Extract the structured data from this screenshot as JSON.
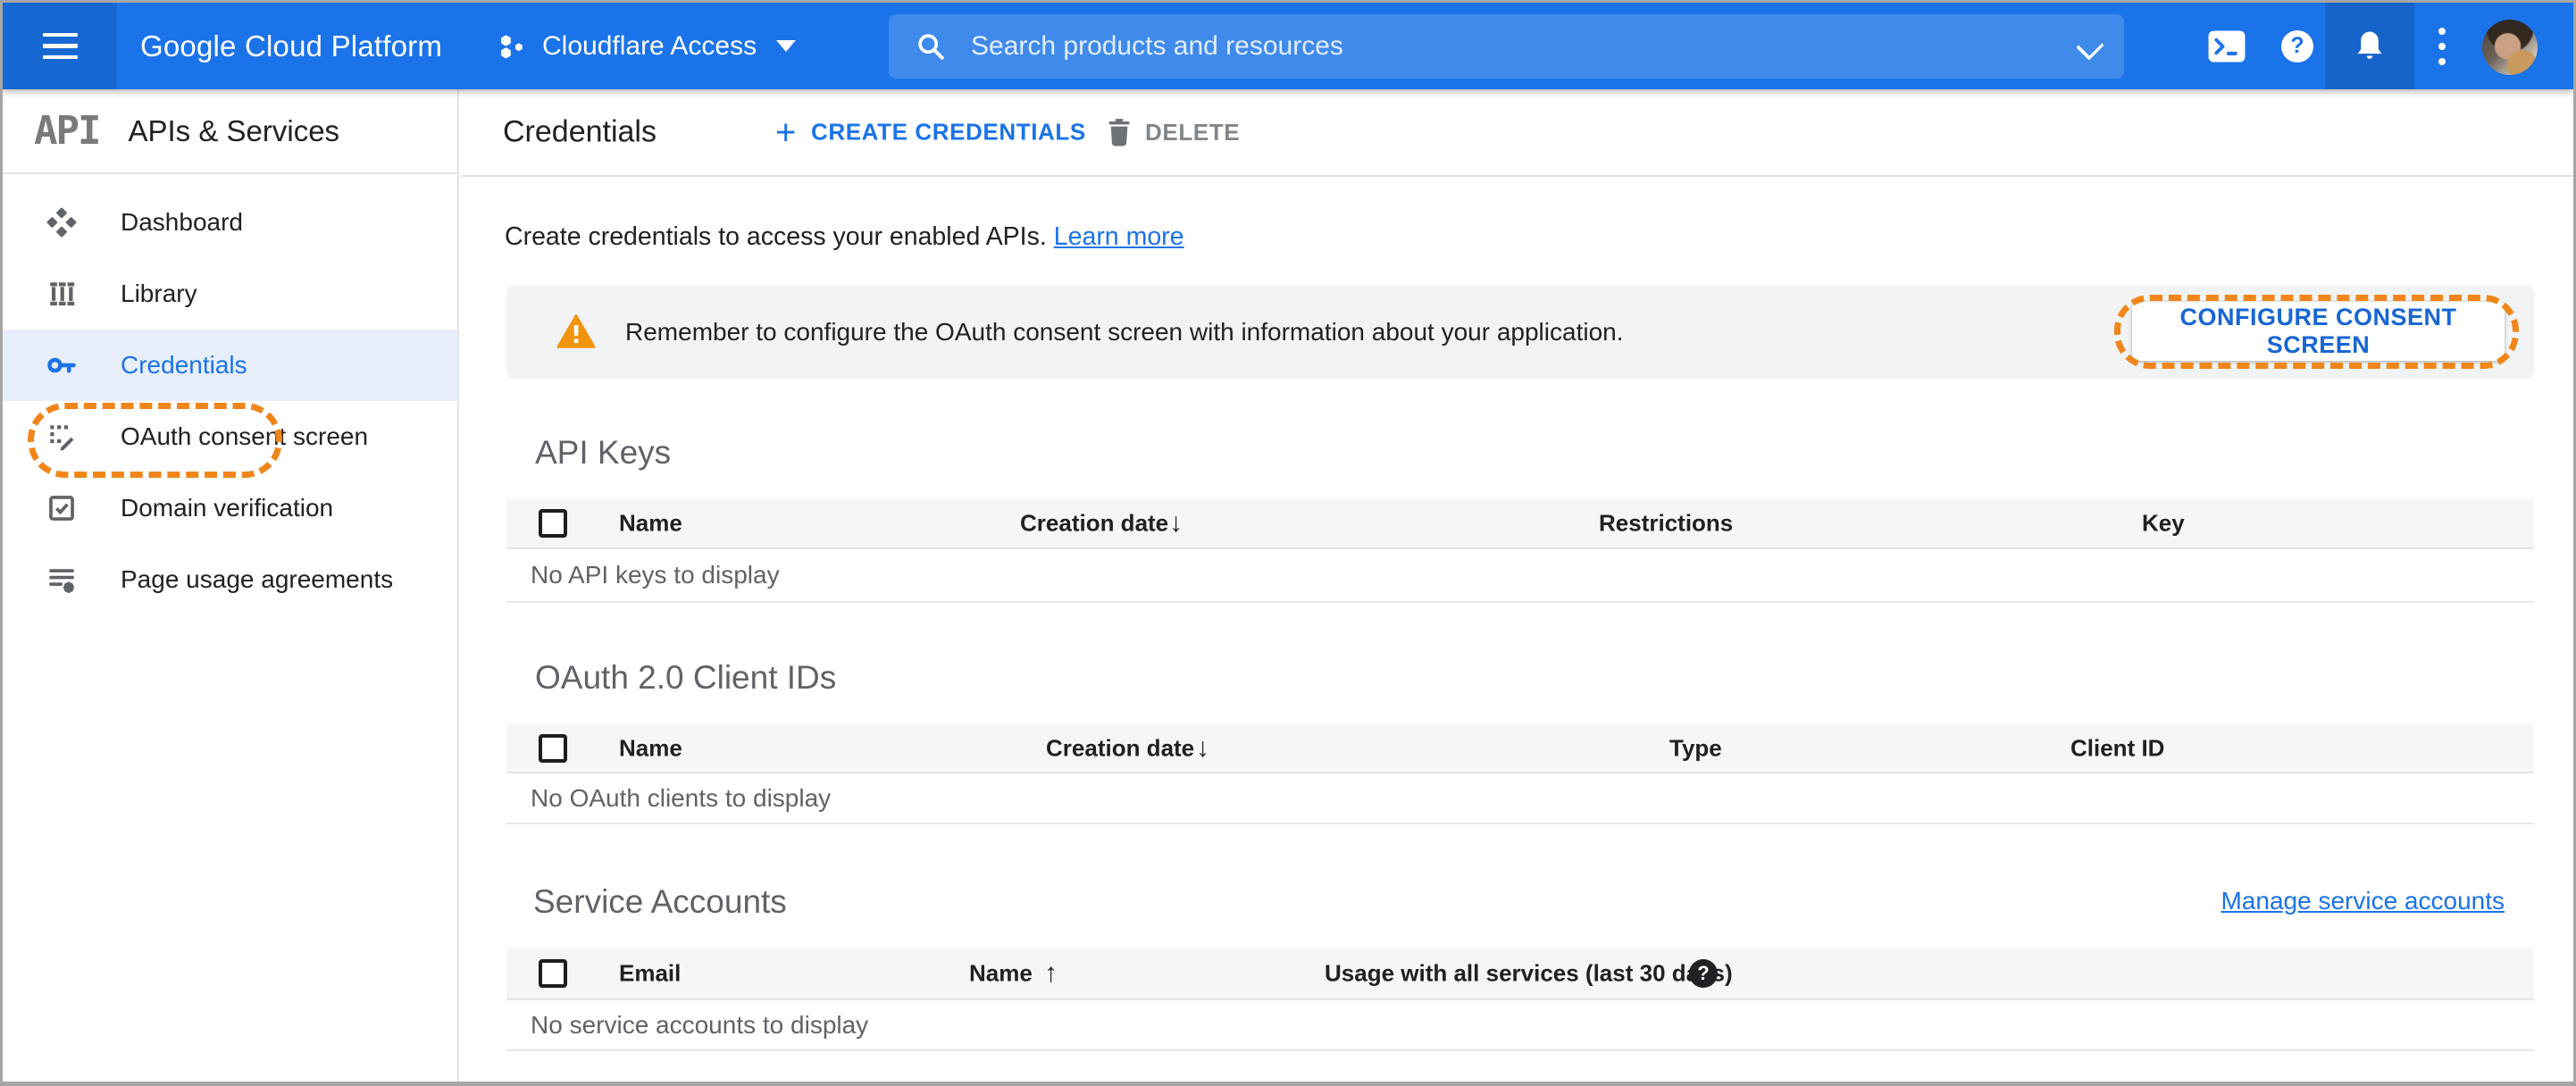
{
  "topbar": {
    "logo": "Google Cloud Platform",
    "project_name": "Cloudflare Access",
    "search_placeholder": "Search products and resources",
    "help_glyph": "?",
    "shell_glyph": ">_"
  },
  "sidebar": {
    "product_glyph": "API",
    "title": "APIs & Services",
    "items": [
      {
        "label": "Dashboard"
      },
      {
        "label": "Library"
      },
      {
        "label": "Credentials"
      },
      {
        "label": "OAuth consent screen"
      },
      {
        "label": "Domain verification"
      },
      {
        "label": "Page usage agreements"
      }
    ],
    "active_item": "Credentials"
  },
  "page_header": {
    "title": "Credentials",
    "create_label": "CREATE CREDENTIALS",
    "delete_label": "DELETE"
  },
  "intro": {
    "text": "Create credentials to access your enabled APIs.",
    "link": "Learn more"
  },
  "banner": {
    "message": "Remember to configure the OAuth consent screen with information about your application.",
    "button": "CONFIGURE CONSENT SCREEN"
  },
  "sections": {
    "api_keys": {
      "title": "API Keys",
      "col_name": "Name",
      "col_creation": "Creation date",
      "col_restrictions": "Restrictions",
      "col_key": "Key",
      "empty": "No API keys to display"
    },
    "oauth": {
      "title": "OAuth 2.0 Client IDs",
      "col_name": "Name",
      "col_creation": "Creation date",
      "col_type": "Type",
      "col_client_id": "Client ID",
      "empty": "No OAuth clients to display"
    },
    "service_accounts": {
      "title": "Service Accounts",
      "manage_link": "Manage service accounts",
      "col_email": "Email",
      "col_name": "Name",
      "col_usage": "Usage with all services (last 30 days)",
      "help_glyph": "?",
      "empty": "No service accounts to display"
    }
  },
  "icons": {
    "plus": "+",
    "sort_desc": "↓",
    "sort_asc": "↑"
  },
  "colors": {
    "topbar_blue": "#1a73e8",
    "topbar_menu_blue": "#1767d2",
    "accent_blue": "#1a73e8",
    "active_item_bg": "#e8eefc",
    "annotation_orange": "#f0861a",
    "warning_orange": "#f2930e",
    "banner_bg": "#f1f3f4",
    "table_header_bg": "#f6f6f6",
    "muted_text": "#5f6368"
  }
}
